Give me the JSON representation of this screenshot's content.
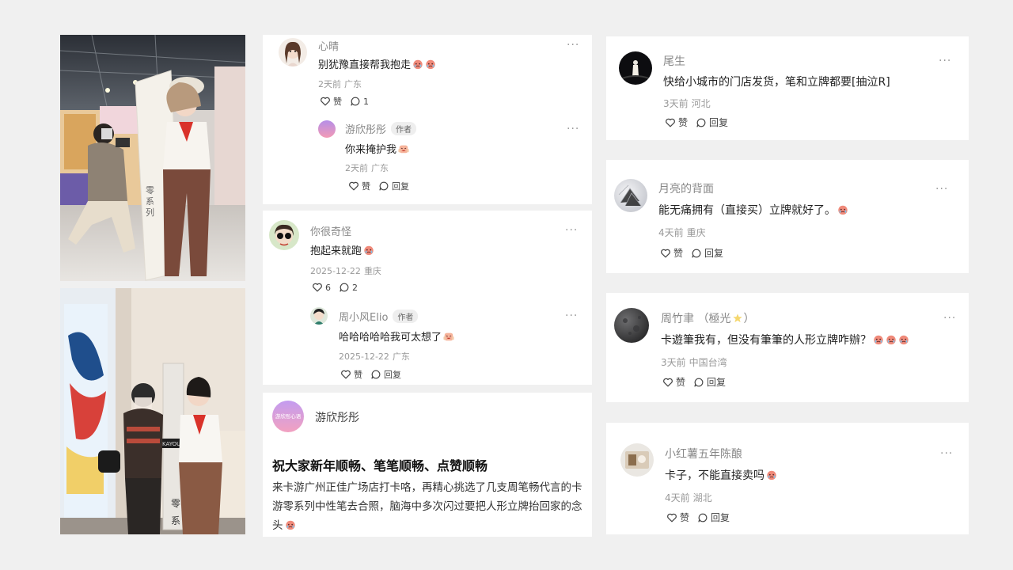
{
  "photos": {
    "top": {
      "standee_lettering": [
        "零",
        "系",
        "列"
      ]
    },
    "bottom": {
      "standee_lettering": [
        "零",
        "系"
      ],
      "pen_brand": "KAYOU"
    }
  },
  "c1": {
    "thread": {
      "user": "心晴",
      "text": "别犹豫直接帮我抱走",
      "time": "2天前",
      "location": "广东",
      "like_label": "赞",
      "reply_count": "1",
      "more": "···"
    },
    "reply": {
      "user": "游欣彤彤",
      "badge": "作者",
      "text": "你来掩护我",
      "time": "2天前",
      "location": "广东",
      "like_label": "赞",
      "reply_label": "回复",
      "more": "···"
    }
  },
  "c2": {
    "thread": {
      "user": "你很奇怪",
      "text": "抱起来就跑",
      "time": "2025-12-22",
      "location": "重庆",
      "like_count": "6",
      "reply_count": "2",
      "more": "···"
    },
    "reply": {
      "user": "周小风Elio",
      "badge": "作者",
      "text": "哈哈哈哈哈我可太想了",
      "time": "2025-12-22",
      "location": "广东",
      "like_label": "赞",
      "reply_label": "回复",
      "more": "···"
    }
  },
  "post": {
    "author": "游欣彤彤",
    "avatar_text": "游欣彤心语",
    "title": "祝大家新年顺畅、笔笔顺畅、点赞顺畅",
    "body": "来卡游广州正佳广场店打卡咯，再精心挑选了几支周笔畅代言的卡游零系列中性笔去合照，脑海中多次闪过要把人形立牌抬回家的念头"
  },
  "r1": {
    "user": "尾生",
    "text": "快给小城市的门店发货，笔和立牌都要[抽泣R]",
    "time": "3天前",
    "location": "河北",
    "like_label": "赞",
    "reply_label": "回复",
    "more": "···"
  },
  "r2": {
    "user": "月亮的背面",
    "text": "能无痛拥有（直接买）立牌就好了。",
    "time": "4天前",
    "location": "重庆",
    "like_label": "赞",
    "reply_label": "回复",
    "more": "···"
  },
  "r3": {
    "user": "周竹聿 （極光",
    "user_suffix": "）",
    "text": "卡遊筆我有，但没有筆筆的人形立牌咋辦？",
    "time": "3天前",
    "location": "中国台湾",
    "like_label": "赞",
    "reply_label": "回复",
    "more": "···"
  },
  "r4": {
    "user": "小红薯五年陈酿",
    "text": "卡子，不能直接卖吗",
    "time": "4天前",
    "location": "湖北",
    "like_label": "赞",
    "reply_label": "回复",
    "more": "···"
  },
  "colors": {
    "background": "#f0f0f0",
    "card": "#ffffff",
    "muted": "#999999",
    "text": "#222222"
  },
  "icons": {
    "like": "heart-outline-icon",
    "reply": "speech-bubble-icon",
    "more": "ellipsis-icon",
    "emoji": "crying-face-emoji",
    "emoji_alt": "laughing-hands-emoji"
  }
}
